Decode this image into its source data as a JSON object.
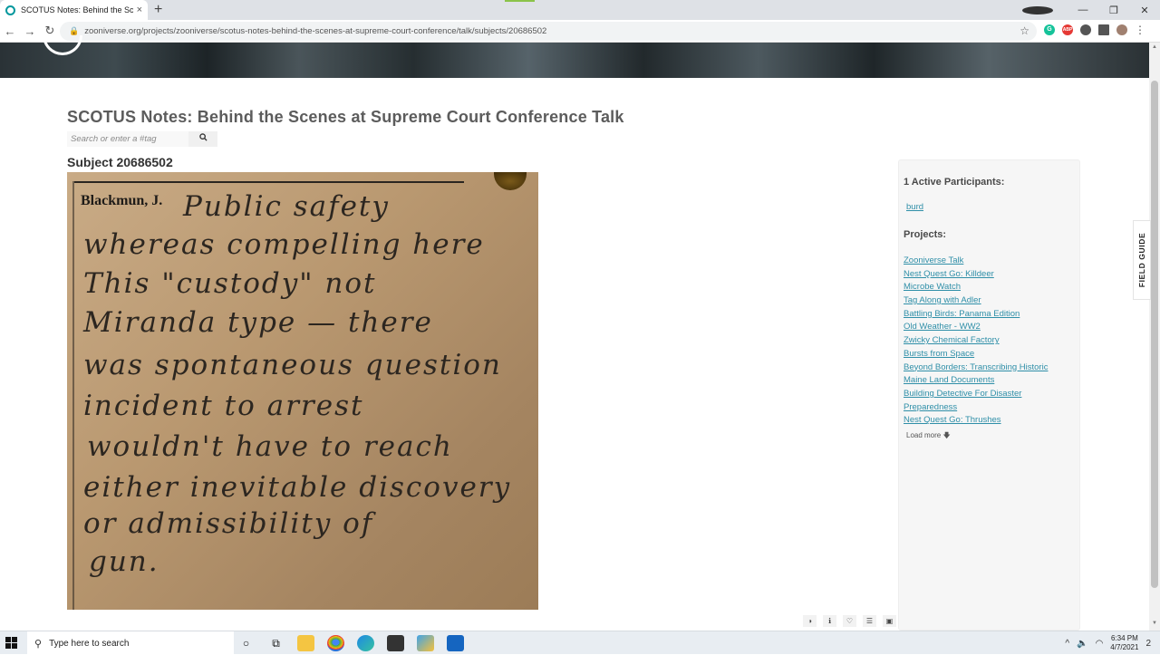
{
  "browser": {
    "tab_title": "SCOTUS Notes: Behind the Scene",
    "tab_close": "×",
    "new_tab": "+",
    "window_controls": [
      "—",
      "❐",
      "✕"
    ],
    "url": "zooniverse.org/projects/zooniverse/scotus-notes-behind-the-scenes-at-supreme-court-conference/talk/subjects/20686502",
    "back": "←",
    "forward": "→",
    "reload": "↻",
    "star": "☆",
    "extensions": [
      {
        "name": "grammarly",
        "color": "#15c39a",
        "label": "G"
      },
      {
        "name": "adblock",
        "color": "#e53935",
        "label": "ABP"
      },
      {
        "name": "puzzle",
        "color": "#555555",
        "label": ""
      },
      {
        "name": "media",
        "color": "#555555",
        "label": ""
      },
      {
        "name": "profile",
        "color": "#a08070",
        "label": ""
      }
    ],
    "menu": "⋮"
  },
  "page": {
    "title": "SCOTUS Notes: Behind the Scenes at Supreme Court Conference Talk",
    "search_placeholder": "Search or enter a #tag",
    "subject_title": "Subject 20686502",
    "note": {
      "printed_name": "Blackmun, J.",
      "handwriting": [
        "Public safety",
        "whereas compelling here",
        "This \"custody\" not",
        "Miranda type — there",
        "was spontaneous question",
        "incident to arrest",
        "wouldn't have to reach",
        "either inevitable discovery",
        "or admissibility of",
        "gun."
      ]
    },
    "image_tools": [
      "◑",
      "ℹ",
      "♡",
      "☰",
      "▣"
    ]
  },
  "sidebar": {
    "participants_heading": "1 Active Participants:",
    "participant": "burd",
    "projects_heading": "Projects:",
    "projects": [
      "Zooniverse Talk",
      "Nest Quest Go: Killdeer",
      "Microbe Watch",
      "Tag Along with Adler",
      "Battling Birds: Panama Edition",
      "Old Weather - WW2",
      "Zwicky Chemical Factory",
      "Bursts from Space",
      "Beyond Borders: Transcribing Historic ",
      "Maine Land Documents",
      "Building Detective For Disaster ",
      "Preparedness",
      "Nest Quest Go: Thrushes"
    ],
    "load_more": "Load more"
  },
  "field_guide": "FIELD GUIDE",
  "taskbar": {
    "search_text": "Type here to search",
    "time": "6:34 PM",
    "date": "4/7/2021",
    "notifications": "2"
  }
}
